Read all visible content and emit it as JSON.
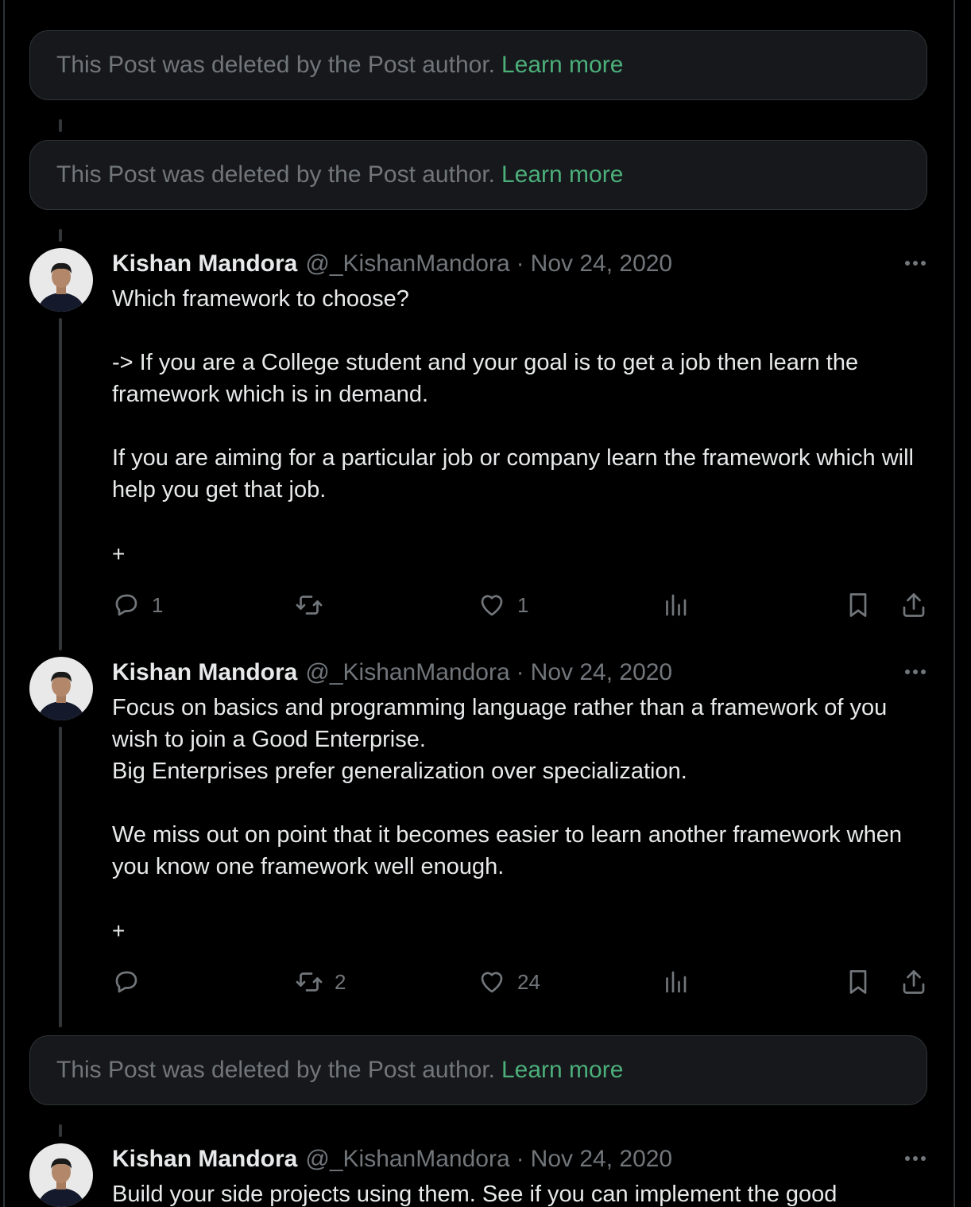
{
  "deleted_notice": {
    "text": "This Post was deleted by the Post author.",
    "link": "Learn more"
  },
  "tweets": [
    {
      "name": "Kishan Mandora",
      "handle": "@_KishanMandora",
      "separator": "·",
      "date": "Nov 24, 2020",
      "body": "Which framework to choose?\n\n-> If you are a College student and your goal is to get a job then learn the framework which is in demand.\n\nIf you are aiming for a particular job or company learn the framework which will help you get that job.",
      "expand": "+",
      "reply_count": "1",
      "retweet_count": "",
      "like_count": "1"
    },
    {
      "name": "Kishan Mandora",
      "handle": "@_KishanMandora",
      "separator": "·",
      "date": "Nov 24, 2020",
      "body": "Focus on basics and programming language rather than a framework of you wish to join a Good Enterprise.\nBig Enterprises prefer generalization over specialization.\n\nWe miss out on point that it becomes easier to learn another framework when you know one framework well enough.",
      "expand": "+",
      "reply_count": "",
      "retweet_count": "2",
      "like_count": "24"
    },
    {
      "name": "Kishan Mandora",
      "handle": "@_KishanMandora",
      "separator": "·",
      "date": "Nov 24, 2020",
      "body": "Build your side projects using them. See if you can implement the good"
    }
  ],
  "icons": {
    "reply": "reply-icon",
    "retweet": "retweet-icon",
    "like": "heart-icon",
    "views": "views-icon",
    "bookmark": "bookmark-icon",
    "share": "share-icon",
    "more": "more-icon"
  },
  "colors": {
    "background": "#000000",
    "card": "#16181c",
    "muted": "#71767b",
    "text": "#e7e9ea",
    "link": "#4caf7a"
  }
}
